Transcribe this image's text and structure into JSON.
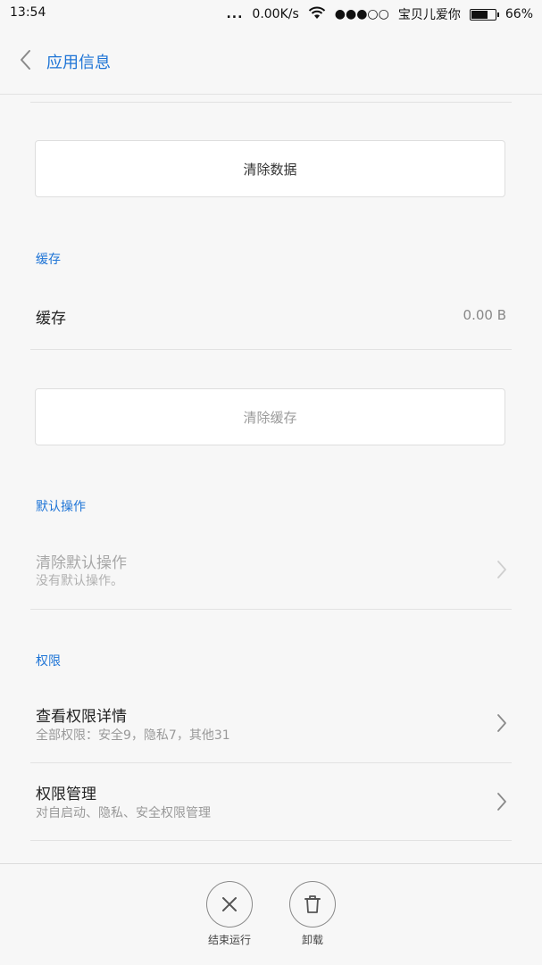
{
  "status_bar": {
    "time": "13:54",
    "dots": "...",
    "network_speed": "0.00K/s",
    "signal": "●●●○○",
    "carrier": "宝贝儿爱你",
    "battery_percent": "66%",
    "battery_level": 0.66
  },
  "header": {
    "title": "应用信息",
    "back_icon": "chevron-left-icon"
  },
  "clear_data_button": "清除数据",
  "cache_section": {
    "title": "缓存",
    "cache_label": "缓存",
    "cache_value": "0.00 B",
    "clear_cache_button": "清除缓存"
  },
  "default_section": {
    "title": "默认操作",
    "clear_default_title": "清除默认操作",
    "clear_default_subtitle": "没有默认操作。"
  },
  "permissions_section": {
    "title": "权限",
    "view_details_title": "查看权限详情",
    "view_details_subtitle": "全部权限：安全9，隐私7，其他31",
    "manage_title": "权限管理",
    "manage_subtitle": "对自启动、隐私、安全权限管理"
  },
  "bottom_actions": {
    "force_stop_label": "结束运行",
    "force_stop_icon": "close-icon",
    "uninstall_label": "卸载",
    "uninstall_icon": "trash-icon"
  },
  "colors": {
    "accent": "#1e74d6",
    "background": "#f7f7f7",
    "disabled_text": "#a8a8a8"
  }
}
